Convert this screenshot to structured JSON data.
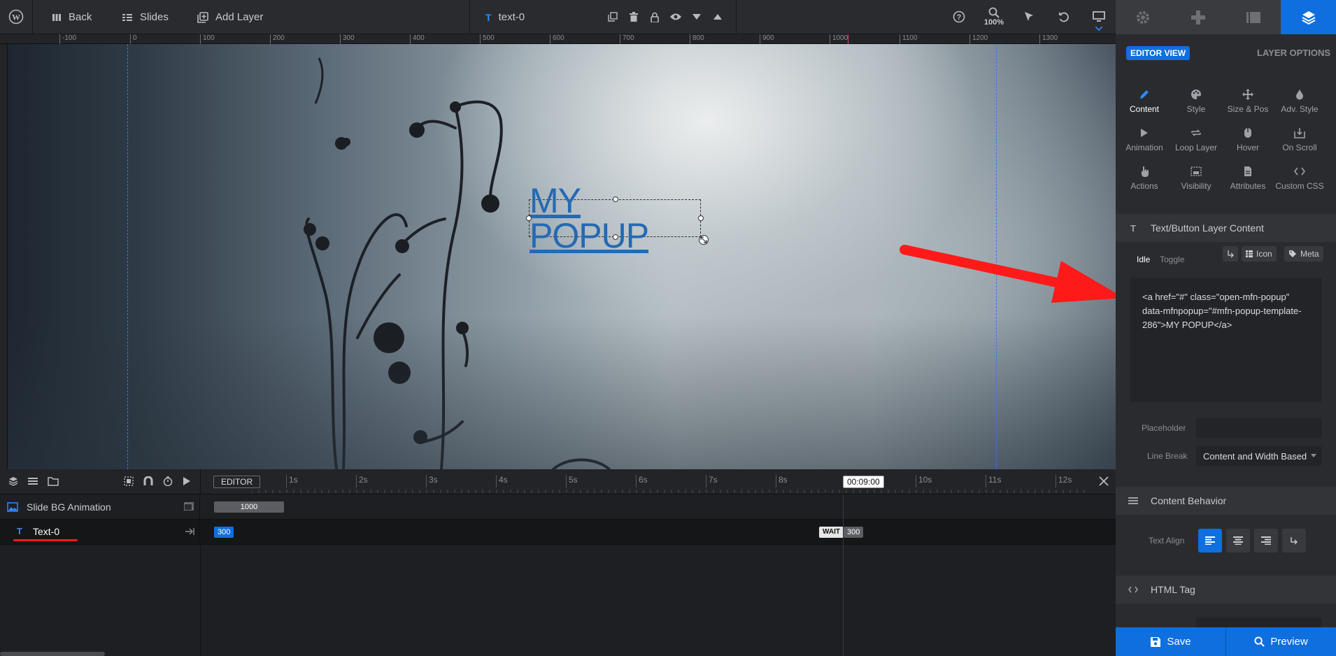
{
  "topbar": {
    "back_label": "Back",
    "slides_label": "Slides",
    "add_layer_label": "Add Layer",
    "layer_name": "text-0",
    "zoom": "100%"
  },
  "ruler": {
    "ticks": [
      "-100",
      "0",
      "100",
      "200",
      "300",
      "400",
      "500",
      "600",
      "700",
      "800",
      "900",
      "1000",
      "1100",
      "1200",
      "1300"
    ]
  },
  "canvas": {
    "layer_text": "MY POPUP"
  },
  "timeline": {
    "editor_label": "EDITOR",
    "time_marks": [
      "1s",
      "2s",
      "3s",
      "4s",
      "5s",
      "6s",
      "7s",
      "8s",
      "9s",
      "10s",
      "11s",
      "12s"
    ],
    "current_time": "00:09:00",
    "rows": [
      {
        "label": "Slide BG Animation",
        "bar_value": "1000"
      },
      {
        "label": "Text-0",
        "start_value": "300",
        "wait_label": "WAIT",
        "end_value": "300"
      }
    ]
  },
  "panel": {
    "editor_view_badge": "EDITOR VIEW",
    "layer_options_label": "LAYER OPTIONS",
    "tabs": [
      {
        "label": "Content",
        "icon": "pencil-icon"
      },
      {
        "label": "Style",
        "icon": "palette-icon"
      },
      {
        "label": "Size & Pos",
        "icon": "move-icon"
      },
      {
        "label": "Adv. Style",
        "icon": "drop-icon"
      },
      {
        "label": "Animation",
        "icon": "play-icon"
      },
      {
        "label": "Loop Layer",
        "icon": "loop-icon"
      },
      {
        "label": "Hover",
        "icon": "mouse-icon"
      },
      {
        "label": "On Scroll",
        "icon": "scroll-icon"
      },
      {
        "label": "Actions",
        "icon": "hand-icon"
      },
      {
        "label": "Visibility",
        "icon": "visibility-icon"
      },
      {
        "label": "Attributes",
        "icon": "file-icon"
      },
      {
        "label": "Custom CSS",
        "icon": "code-icon"
      }
    ],
    "content_section_title": "Text/Button Layer Content",
    "idle_label": "Idle",
    "toggle_label": "Toggle",
    "icon_button": "Icon",
    "meta_button": "Meta",
    "code_text": "<a href=\"#\" class=\"open-mfn-popup\" data-mfnpopup=\"#mfn-popup-template-286\">MY POPUP</a>",
    "placeholder_label": "Placeholder",
    "placeholder_value": "",
    "line_break_label": "Line Break",
    "line_break_value": "Content and Width Based",
    "content_behavior_title": "Content Behavior",
    "text_align_label": "Text Align",
    "html_tag_title": "HTML Tag",
    "save_label": "Save",
    "preview_label": "Preview"
  },
  "colors": {
    "accent": "#0f6fde",
    "arrow": "#ff1a1a",
    "popup_text": "#2569b3"
  }
}
